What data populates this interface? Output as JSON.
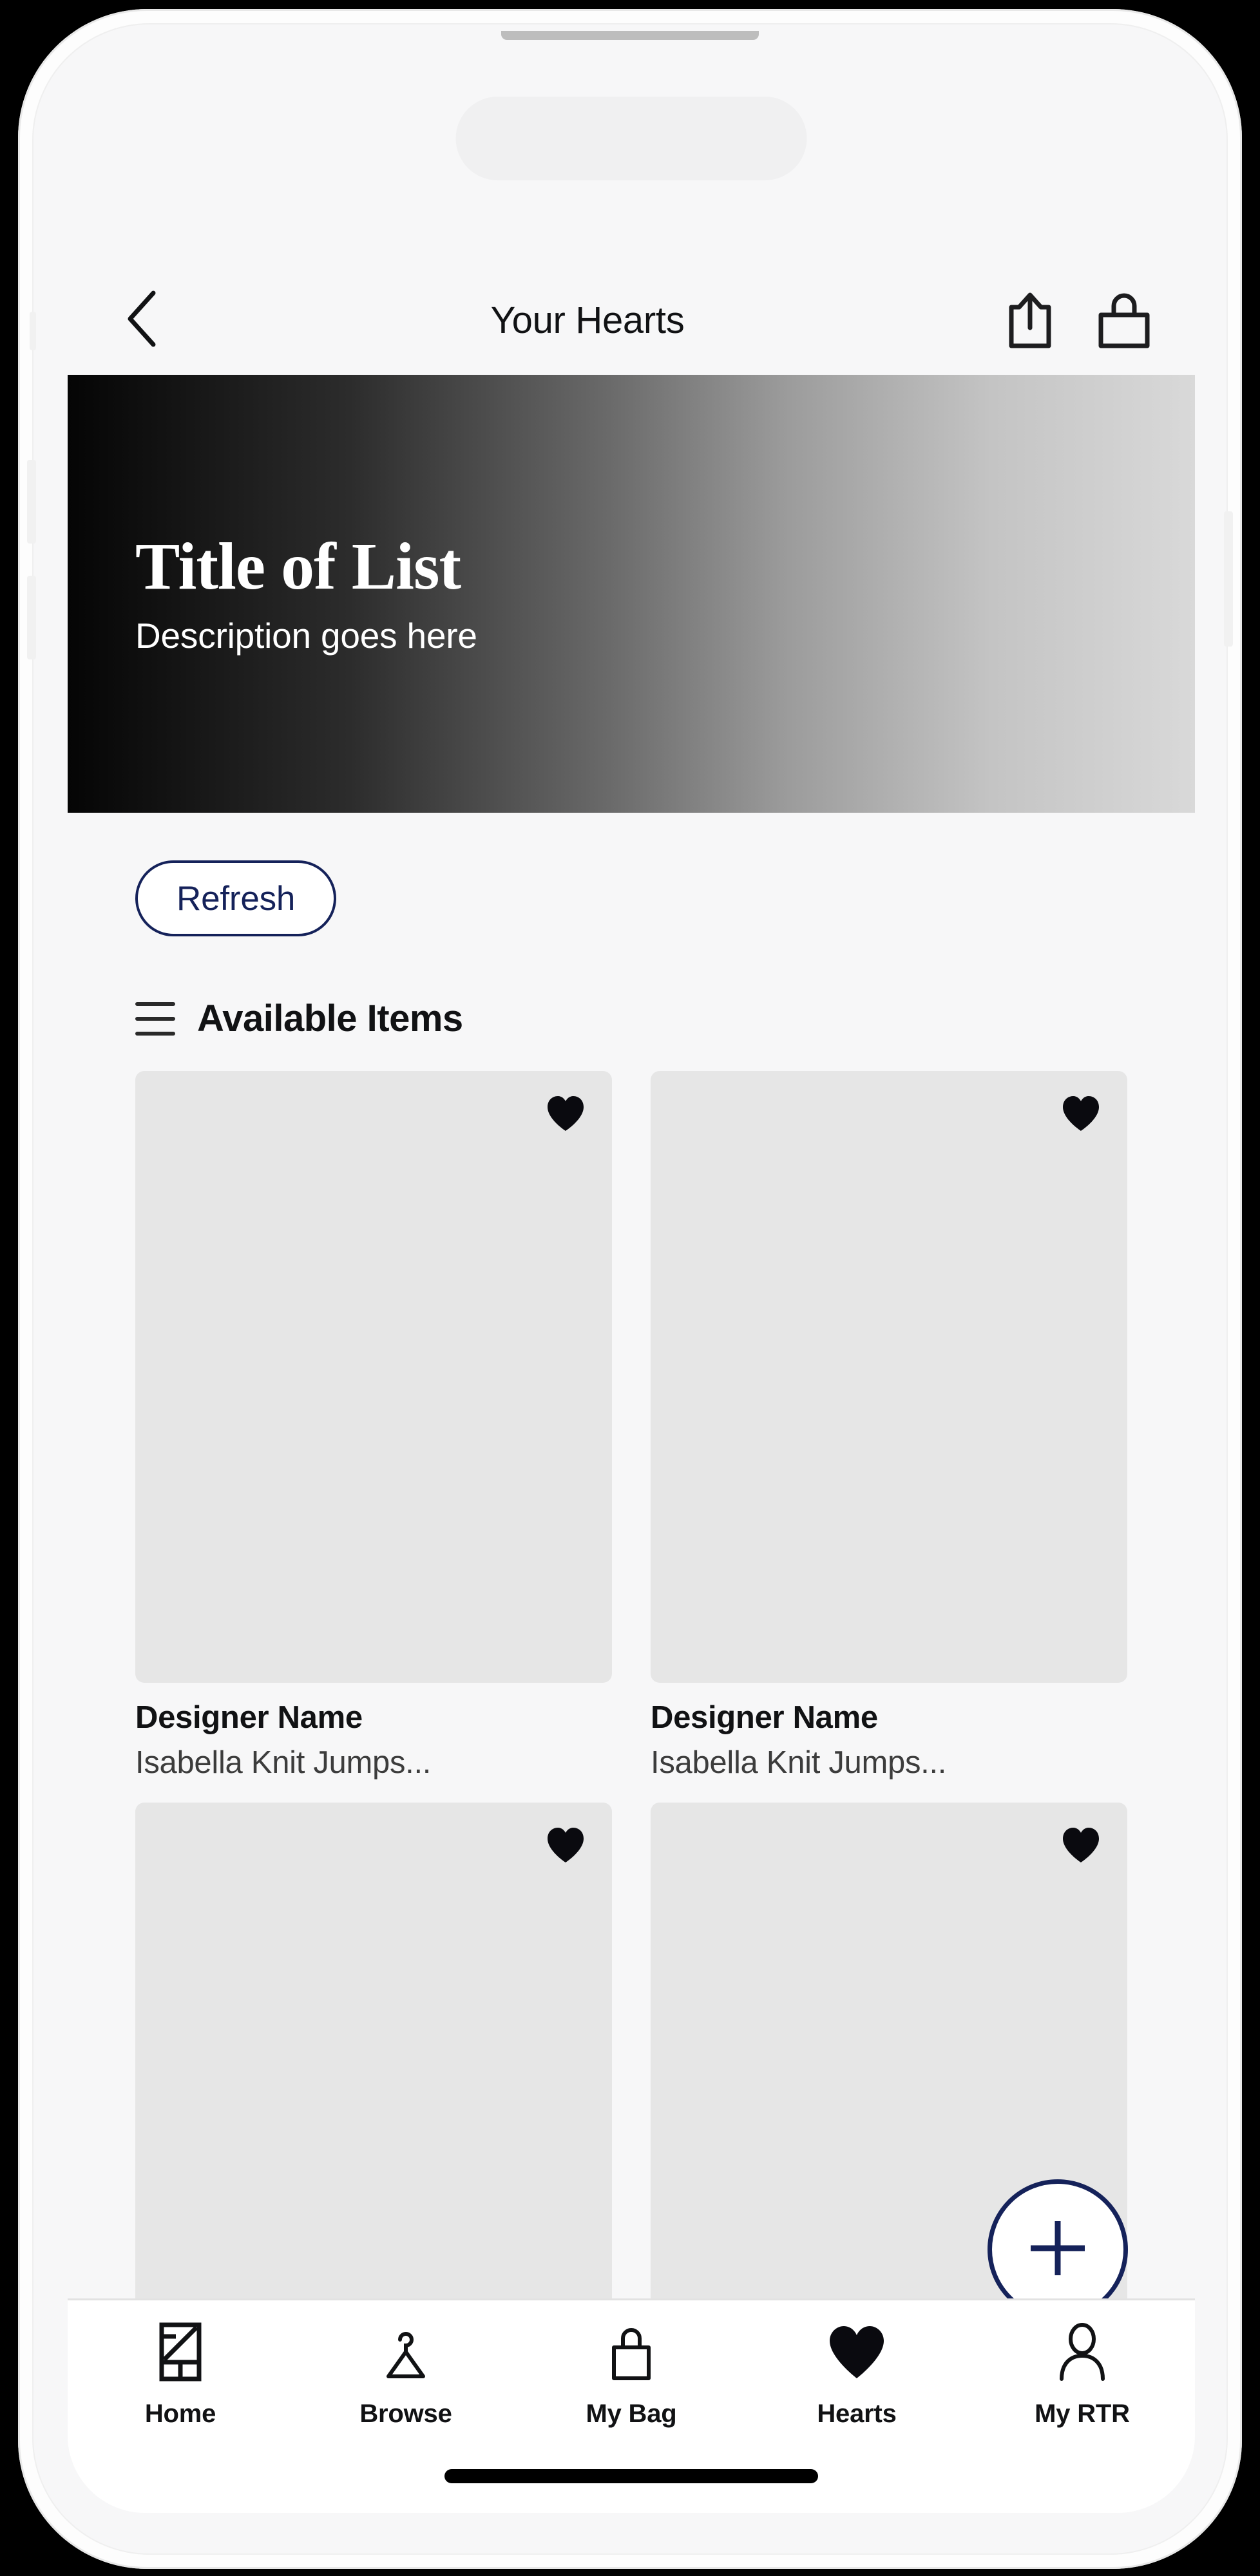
{
  "device": {
    "frame_color": "#fdfdfd",
    "screen_background": "#f7f7f8",
    "home_indicator": "home-indicator"
  },
  "header": {
    "back_icon": "chevron-left-icon",
    "title": "Your Hearts",
    "share_icon": "share-icon",
    "bag_icon": "shopping-bag-icon"
  },
  "hero": {
    "title": "Title of List",
    "description": "Description goes here",
    "gradient_from": "#050505",
    "gradient_to": "#d9d9d9"
  },
  "controls": {
    "refresh_label": "Refresh",
    "accent_color": "#15225a"
  },
  "section": {
    "filter_icon": "filter-lines-icon",
    "title": "Available Items"
  },
  "products": [
    {
      "brand": "Designer Name",
      "name": "Isabella Knit Jumps...",
      "heart_icon": "heart-filled-icon",
      "hearted": true
    },
    {
      "brand": "Designer Name",
      "name": "Isabella Knit Jumps...",
      "heart_icon": "heart-filled-icon",
      "hearted": true
    },
    {
      "brand": "",
      "name": "",
      "heart_icon": "heart-filled-icon",
      "hearted": true
    },
    {
      "brand": "",
      "name": "",
      "heart_icon": "heart-filled-icon",
      "hearted": true
    }
  ],
  "fab": {
    "icon": "plus-icon",
    "color": "#15225a"
  },
  "tabbar": {
    "items": [
      {
        "label": "Home",
        "icon": "home-grid-icon",
        "active": false
      },
      {
        "label": "Browse",
        "icon": "hanger-icon",
        "active": false
      },
      {
        "label": "My Bag",
        "icon": "shopping-bag-icon",
        "active": false
      },
      {
        "label": "Hearts",
        "icon": "heart-filled-icon",
        "active": true
      },
      {
        "label": "My RTR",
        "icon": "person-icon",
        "active": false
      }
    ]
  }
}
